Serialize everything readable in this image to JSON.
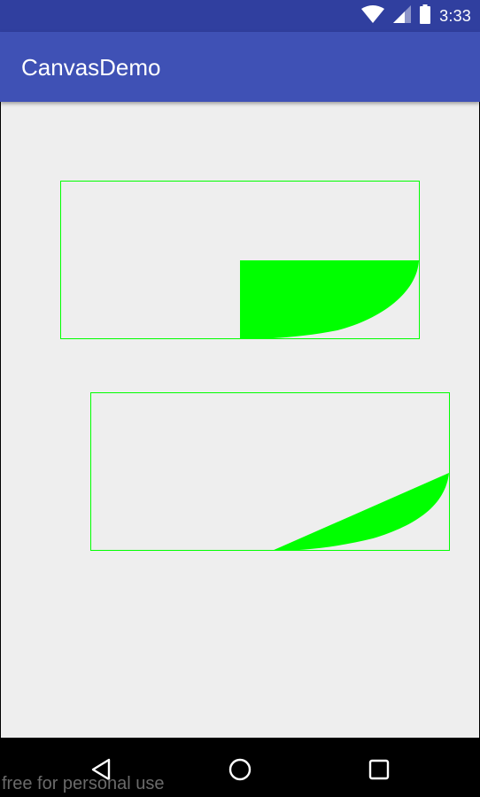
{
  "status_bar": {
    "time": "3:33",
    "icons": [
      "wifi-icon",
      "cellular-signal-icon",
      "battery-icon"
    ]
  },
  "app_bar": {
    "title": "CanvasDemo"
  },
  "canvas": {
    "background_color": "#eeeeee",
    "stroke_color": "#00ff00",
    "fill_color": "#00ff00",
    "shapes": [
      "upper-arc-rectangle",
      "lower-arc-rectangle"
    ]
  },
  "nav_bar": {
    "buttons": [
      "back-icon",
      "home-icon",
      "recents-icon"
    ]
  },
  "watermark": {
    "text": "free for personal use"
  },
  "colors": {
    "status_bar": "#303f9f",
    "app_bar": "#3f51b5",
    "accent_green": "#00ff00"
  }
}
